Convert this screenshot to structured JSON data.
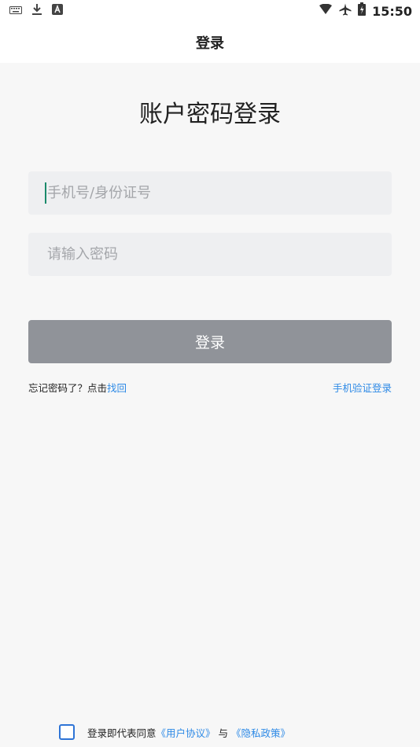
{
  "status_bar": {
    "time": "15:50",
    "left_icons": [
      "keyboard-icon",
      "download-icon",
      "text-icon"
    ],
    "right_icons": [
      "wifi-icon",
      "airplane-icon",
      "battery-icon"
    ]
  },
  "header": {
    "title": "登录"
  },
  "page_title": "账户密码登录",
  "form": {
    "phone_placeholder": "手机号/身份证号",
    "password_placeholder": "请输入密码",
    "login_button": "登录"
  },
  "links": {
    "forgot_prefix": "忘记密码了？点击",
    "forgot_link": "找回",
    "sms_login": "手机验证登录"
  },
  "agreement": {
    "prefix": "登录即代表同意",
    "user_agreement": "《用户协议》",
    "connector": "与",
    "privacy_policy": "《隐私政策》"
  },
  "colors": {
    "accent": "#2e8ae6",
    "button_disabled": "#909399",
    "field_bg": "#eeeff1",
    "caret": "#1a8a6b"
  }
}
